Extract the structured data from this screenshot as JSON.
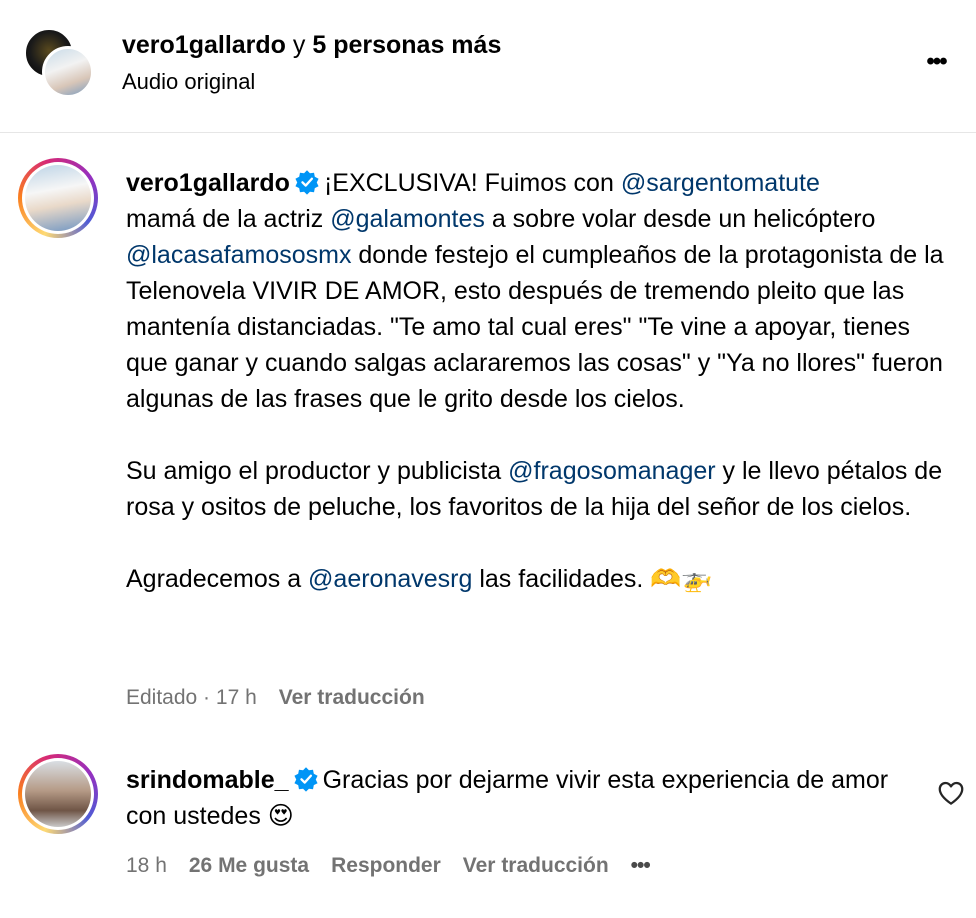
{
  "header": {
    "username": "vero1gallardo",
    "connector": " y ",
    "others": "5 personas más",
    "audio": "Audio original"
  },
  "post": {
    "username": "vero1gallardo",
    "p1_a": "¡EXCLUSIVA! Fuimos con ",
    "m1": "@sargentomatute",
    "p1_b": "mamá de la actriz ",
    "m2": "@galamontes",
    "p1_c": " a sobre volar desde un helicóptero ",
    "m3": "@lacasafamososmx",
    "p1_d": " donde festejo el cumpleaños de la protagonista de la Telenovela VIVIR DE AMOR, esto después de tremendo pleito que las mantenía distanciadas. \"Te amo tal cual eres\" \"Te vine a apoyar, tienes que ganar y cuando salgas aclararemos las cosas\" y \"Ya no llores\" fueron algunas de las frases que le grito desde los cielos.",
    "p2_a": "Su amigo el productor y publicista ",
    "m4": "@fragosomanager",
    "p2_b": " y le llevo pétalos de rosa y ositos de peluche, los favoritos de la hija del señor de los cielos.",
    "p3_a": "Agradecemos a ",
    "m5": "@aeronavesrg",
    "p3_b": " las facilidades. ",
    "p3_emoji": "🫶🚁",
    "edited": "Editado · 17 h",
    "translate": "Ver traducción"
  },
  "comment": {
    "username": "srindomable_",
    "text": "Gracias por dejarme vivir esta experiencia de amor con ustedes ",
    "emoji": "😍",
    "time": "18 h",
    "likes": "26 Me gusta",
    "reply": "Responder",
    "translate": "Ver traducción",
    "more": "•••"
  },
  "icons": {
    "verified_color": "#0095f6",
    "mention_color": "#00376b",
    "meta_color": "#737373"
  }
}
